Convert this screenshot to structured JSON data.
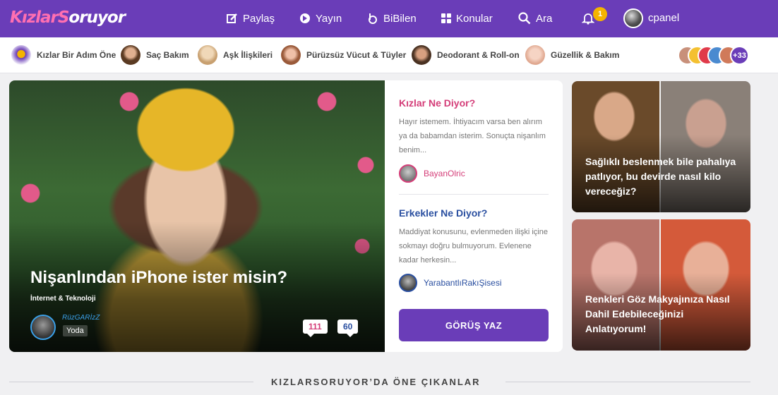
{
  "header": {
    "logo_part1": "Kızlar",
    "logo_part2": "S",
    "logo_part3": "oruyor",
    "nav": {
      "share": "Paylaş",
      "publish": "Yayın",
      "bibilen": "BiBilen",
      "topics": "Konular",
      "search": "Ara"
    },
    "notification_count": "1",
    "username": "cpanel"
  },
  "categories": [
    {
      "label": "Kızlar Bir Adım Öne",
      "color": "#6a3db8"
    },
    {
      "label": "Saç Bakım",
      "color": "#8a5a3a"
    },
    {
      "label": "Aşk İlişkileri",
      "color": "#d8c0a0"
    },
    {
      "label": "Pürüzsüz Vücut & Tüyler",
      "color": "#c8806a"
    },
    {
      "label": "Deodorant & Roll-on",
      "color": "#7a5a3a"
    },
    {
      "label": "Güzellik & Bakım",
      "color": "#e8b8a8"
    }
  ],
  "more_categories": "+33",
  "hero": {
    "title": "Nişanlından iPhone ister misin?",
    "category": "İnternet & Teknoloji",
    "author": "RüzGARİzZ",
    "author_rank": "Yoda",
    "female_count": "111",
    "male_count": "60",
    "girls_heading": "Kızlar Ne Diyor?",
    "girls_text": "Hayır istemem. İhtiyacım varsa ben alırım ya da babamdan isterim. Sonuçta nişanlım benim...",
    "girls_user": "BayanOlric",
    "boys_heading": "Erkekler Ne Diyor?",
    "boys_text": "Maddiyat konusunu, evlenmeden ilişki içine sokmayı doğru bulmuyorum. Evlenene kadar herkesin...",
    "boys_user": "YarabantlıRakıŞisesi",
    "cta": "GÖRÜŞ YAZ"
  },
  "side_cards": [
    {
      "title": "Sağlıklı beslenmek bile pahalıya patlıyor, bu devirde nasıl kilo vereceğiz?"
    },
    {
      "title": "Renkleri Göz Makyajınıza Nasıl Dahil Edebileceğinizi Anlatıyorum!"
    }
  ],
  "section_title": "KIZLARSORUYOR’DA ÖNE ÇIKANLAR",
  "colors": {
    "brand": "#6a3db8",
    "girls": "#d43d78",
    "boys": "#2a4fa0",
    "badge": "#f4b400"
  }
}
